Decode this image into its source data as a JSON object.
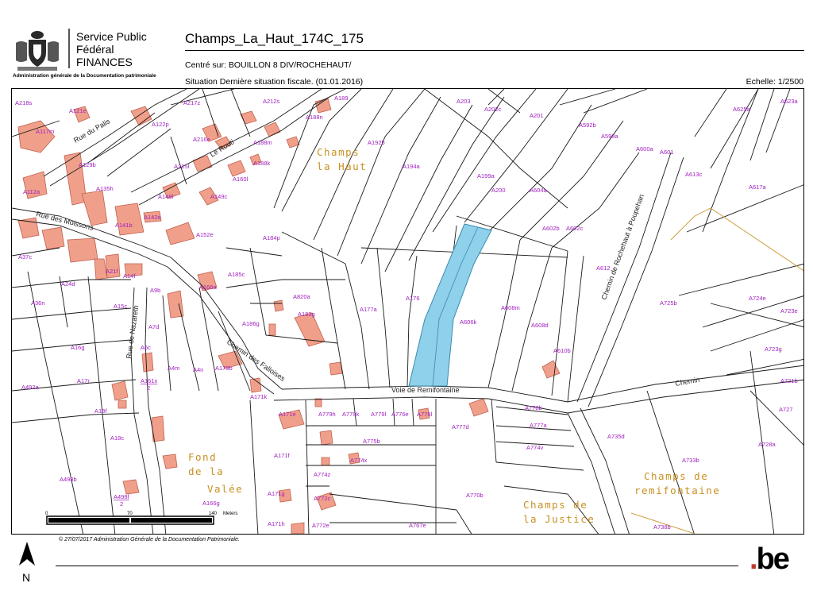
{
  "header": {
    "org_line1": "Service Public",
    "org_line2": "Fédéral",
    "org_line3": "FINANCES",
    "org_subtitle": "Administration générale de la Documentation patrimoniale",
    "title": "Champs_La_Haut_174C_175",
    "centre": "Centré sur: BOUILLON 8 DIV/ROCHEHAUT/",
    "situation": "Situation Dernière situation fiscale. (01.01.2016)",
    "scale": "Echelle: 1/2500"
  },
  "colors": {
    "parcel_line": "#1a1a1a",
    "building_fill": "#f0a08a",
    "building_stroke": "#c06050",
    "highlight_fill": "#8fd0ea",
    "highlight_stroke": "#3a8ab0",
    "parcel_label": "#a020c0",
    "place_label": "#c89020",
    "boundary_dashed": "#d0a040"
  },
  "map": {
    "parcels": [
      "A218s",
      "A121e",
      "A117m",
      "A122p",
      "A217z",
      "A212s",
      "A189",
      "A203",
      "A202c",
      "A201",
      "A592b",
      "A625a",
      "A623a",
      "A216e",
      "A188m",
      "A188n",
      "A599a",
      "A600a",
      "A601",
      "A613c",
      "A129b",
      "A215l",
      "A188k",
      "A192b",
      "A194a",
      "A199a",
      "A200",
      "A604a",
      "A617a",
      "A135h",
      "A160l",
      "A149c",
      "A148l",
      "A112a",
      "A142e",
      "A141b",
      "A152e",
      "A184p",
      "A602b",
      "A602c",
      "A37c",
      "A21f",
      "A14f",
      "A15c",
      "A24d",
      "A9b",
      "A185c",
      "A820a",
      "A183g",
      "A177a",
      "A176",
      "A606k",
      "A608m",
      "A608d",
      "A612",
      "A725b",
      "A724e",
      "A723e",
      "A36n",
      "A166a",
      "A186g",
      "A610b",
      "A723g",
      "A16g",
      "A7d",
      "A6c",
      "A4m",
      "A4n",
      "A179b",
      "A492a",
      "A17r",
      "A161x 2",
      "A171k",
      "A779h",
      "A779k",
      "A779l",
      "A776e",
      "A776l",
      "A778b",
      "A721b",
      "A18f",
      "A171e",
      "A777d",
      "A777a",
      "A727",
      "A735d",
      "A18c",
      "A775b",
      "A774v",
      "A728a",
      "A171f",
      "A774x",
      "A733b",
      "A498b",
      "A498f 2",
      "A166g",
      "A171g",
      "A774z",
      "A772c",
      "A770b",
      "A171h",
      "A772e",
      "A767e",
      "A738b"
    ],
    "streets": [
      "Rue du Palis",
      "Le Routi",
      "Rue des Moissons",
      "Rue de Nazareth",
      "Chemin des Falloises",
      "Voie de Remifontaine",
      "Chemin de Rochehaut à Poupehan",
      "Chemin"
    ],
    "places": [
      "Champs",
      "la Haut",
      "Fond",
      "de la",
      "Valée",
      "Champs de",
      "la Justice",
      "Champs de",
      "remifontaine"
    ],
    "scalebar": {
      "ticks": [
        "0",
        "70",
        "140"
      ],
      "unit": "Meters"
    }
  },
  "footer": {
    "copyright": "© 27/07/2017 Administration Générale de la Documentation Patrimoniale.",
    "north_label": "N",
    "be_logo_dot": ".",
    "be_logo_text": "be"
  }
}
